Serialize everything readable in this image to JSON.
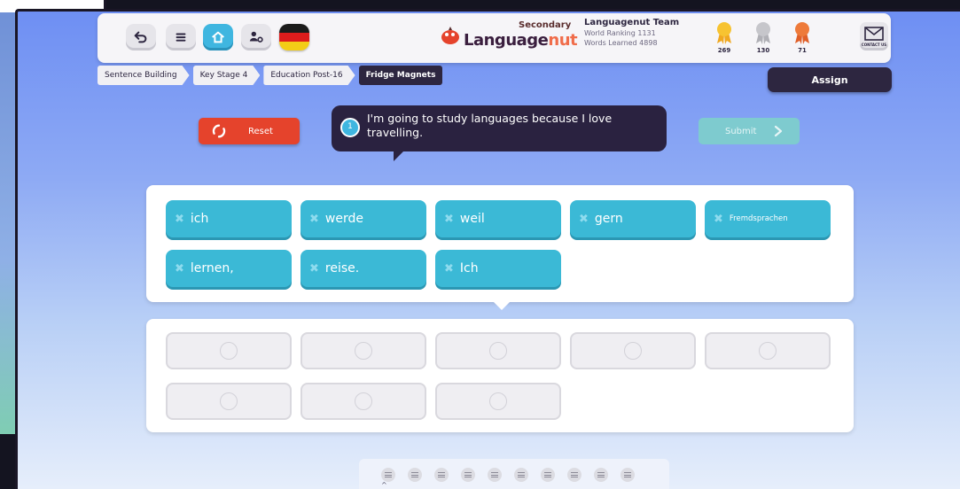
{
  "header": {
    "logo_secondary": "Secondary",
    "logo_main_a": "Language",
    "logo_main_b": "nut",
    "team_name": "Languagenut Team",
    "world_ranking": "World Ranking 1131",
    "words_learned": "Words Learned 4898",
    "medals": [
      {
        "color": "#f7c331",
        "count": "269"
      },
      {
        "color": "#c6c6cb",
        "count": "130"
      },
      {
        "color": "#ee7a3a",
        "count": "71"
      }
    ],
    "contact_label": "CONTACT US"
  },
  "breadcrumb": [
    "Sentence Building",
    "Key Stage 4",
    "Education Post-16",
    "Fridge Magnets"
  ],
  "assign_label": "Assign",
  "reset_label": "Reset",
  "prompt": {
    "number": "1",
    "text": "I'm going to study languages because I love travelling."
  },
  "submit_label": "Submit",
  "words": [
    "ich",
    "werde",
    "weil",
    "gern",
    "Fremdsprachen",
    "lernen,",
    "reise.",
    "Ich"
  ],
  "answer_slots": 8,
  "pager_count": 10,
  "colors": {
    "accent_blue": "#3bb9d6",
    "reset_red": "#e5432c",
    "submit_teal": "#7ecbcf",
    "dark": "#2d2640"
  }
}
